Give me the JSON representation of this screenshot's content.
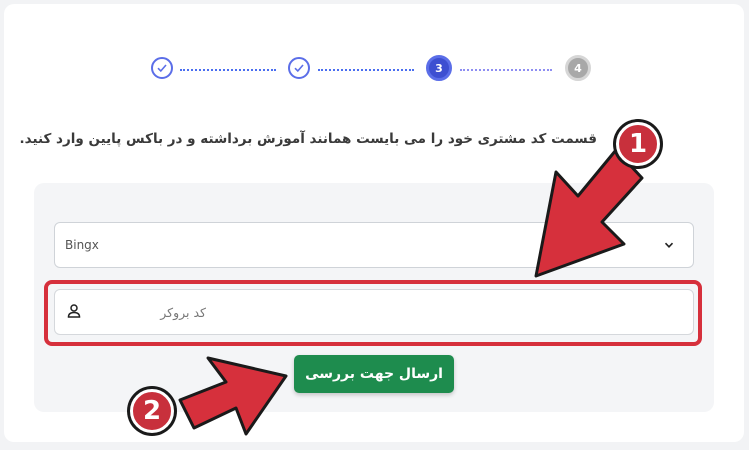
{
  "stepper": {
    "steps": [
      {
        "label": "",
        "state": "done",
        "icon": "check-icon"
      },
      {
        "label": "",
        "state": "done",
        "icon": "check-icon"
      },
      {
        "label": "3",
        "state": "active"
      },
      {
        "label": "4",
        "state": "pending"
      }
    ]
  },
  "instruction": "قسمت کد مشتری خود را می بایست همانند آموزش برداشته و در باکس پایین وارد کنید.",
  "form": {
    "broker_select": {
      "value": "Bingx",
      "icon": "chevron-down-icon"
    },
    "broker_code_input": {
      "value": "",
      "placeholder": "کد بروکر",
      "icon": "user-icon"
    },
    "submit_label": "ارسال جهت بررسی"
  },
  "annotations": {
    "badge_1": "1",
    "badge_2": "2",
    "highlight_color": "#d6303c",
    "arrow_color": "#d6303c"
  },
  "colors": {
    "accent": "#5b6ee8",
    "submit_bg": "#1e8c4e"
  }
}
